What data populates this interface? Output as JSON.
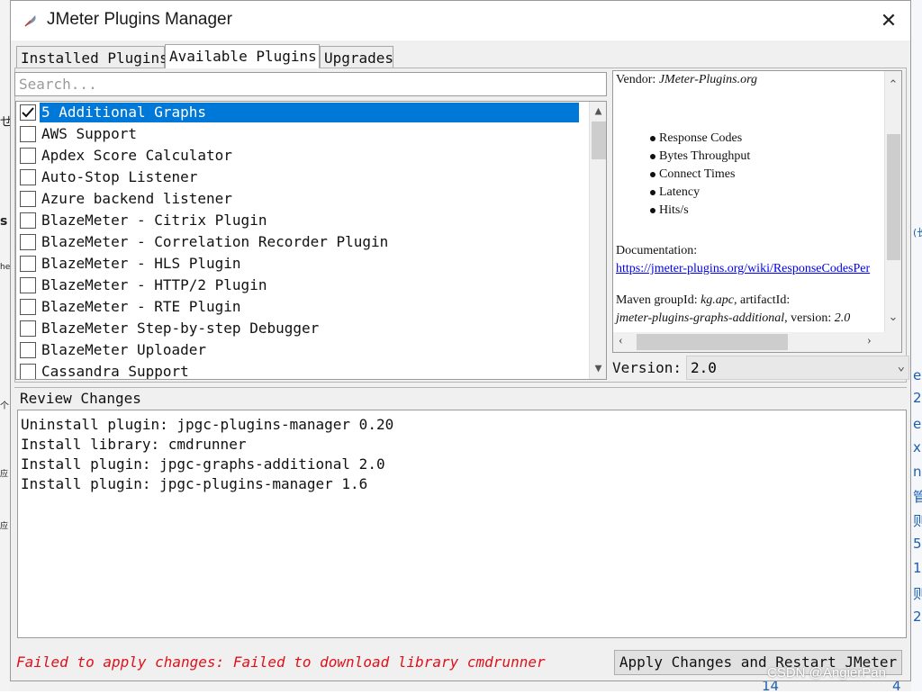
{
  "window": {
    "title": "JMeter Plugins Manager",
    "close_glyph": "✕"
  },
  "tabs": [
    {
      "label": "Installed Plugins"
    },
    {
      "label": "Available Plugins"
    },
    {
      "label": "Upgrades"
    }
  ],
  "active_tab": "Available Plugins",
  "search": {
    "placeholder": "Search..."
  },
  "plugins": [
    {
      "label": "5 Additional Graphs",
      "checked": true,
      "selected": true
    },
    {
      "label": "AWS Support",
      "checked": false
    },
    {
      "label": "Apdex Score Calculator",
      "checked": false
    },
    {
      "label": "Auto-Stop Listener",
      "checked": false
    },
    {
      "label": "Azure backend listener",
      "checked": false
    },
    {
      "label": "BlazeMeter - Citrix Plugin",
      "checked": false
    },
    {
      "label": "BlazeMeter - Correlation Recorder Plugin",
      "checked": false
    },
    {
      "label": "BlazeMeter - HLS Plugin",
      "checked": false
    },
    {
      "label": "BlazeMeter - HTTP/2 Plugin",
      "checked": false
    },
    {
      "label": "BlazeMeter - RTE Plugin",
      "checked": false
    },
    {
      "label": "BlazeMeter Step-by-step Debugger",
      "checked": false
    },
    {
      "label": "BlazeMeter Uploader",
      "checked": false
    },
    {
      "label": "Cassandra Support",
      "checked": false
    }
  ],
  "details": {
    "vendor_label": "Vendor:",
    "vendor_value": "JMeter-Plugins.org",
    "bullets": [
      "Response Codes",
      "Bytes Throughput",
      "Connect Times",
      "Latency",
      "Hits/s"
    ],
    "documentation_label": "Documentation:",
    "documentation_link": "https://jmeter-plugins.org/wiki/ResponseCodesPer",
    "maven_prefix": "Maven groupId:",
    "maven_group": "kg.apc",
    "maven_artifact_label": ", artifactId:",
    "maven_artifact": "jmeter-plugins-graphs-additional",
    "maven_version_label": ", version:",
    "maven_version": "2.0"
  },
  "version": {
    "label": "Version:",
    "value": "2.0"
  },
  "review": {
    "title": "Review Changes",
    "lines": [
      "Uninstall plugin: jpgc-plugins-manager 0.20",
      "Install library: cmdrunner",
      "Install plugin: jpgc-graphs-additional 2.0",
      "Install plugin: jpgc-plugins-manager 1.6"
    ]
  },
  "error_message": "Failed to apply changes: Failed to download library cmdrunner",
  "apply_button": "Apply Changes and Restart JMeter",
  "watermark": "CSDN @AngierPan",
  "background": {
    "left_glyphs": [
      "せ",
      "s",
      "he",
      "个",
      "应",
      "应"
    ],
    "right_glyphs": [
      "(长",
      "e",
      "2",
      "e",
      "x(",
      "ni",
      "管",
      "则",
      "5",
      "1",
      "则",
      "2"
    ],
    "bottom_numbers": [
      "14",
      "4"
    ]
  },
  "colors": {
    "selection": "#0078d7",
    "error": "#e0101a",
    "link": "#0000ee"
  }
}
